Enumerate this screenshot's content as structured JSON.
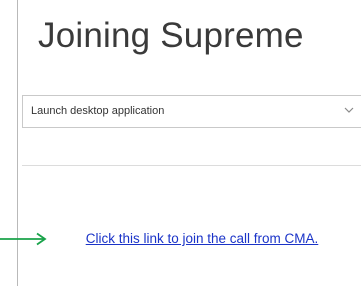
{
  "heading": {
    "title": "Joining Supreme"
  },
  "launch_select": {
    "selected": "Launch desktop application"
  },
  "join_link": {
    "text": "Click this link to join the call from CMA."
  },
  "colors": {
    "link": "#1a33c8",
    "arrow": "#19a34a"
  },
  "icons": [
    "chevron-down-icon",
    "arrow-right-icon"
  ]
}
